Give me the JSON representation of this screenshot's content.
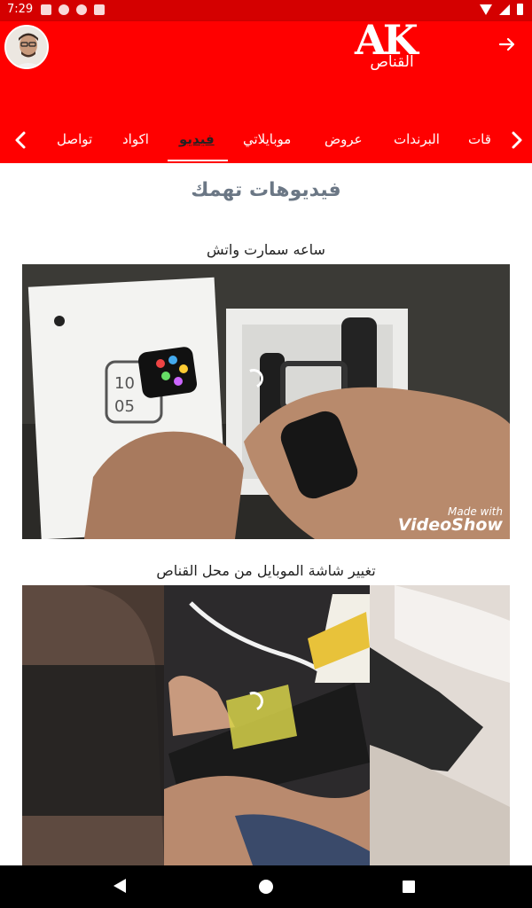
{
  "status_bar": {
    "time": "7:29",
    "icons": [
      "notification-icon",
      "notification-icon",
      "notification-icon",
      "sd-card-icon",
      "wifi-icon",
      "signal-icon",
      "battery-icon"
    ]
  },
  "header": {
    "logo_text": "AK",
    "logo_subtext": "القناص",
    "forward_icon": "arrow-right-icon",
    "avatar_icon": "user-avatar",
    "background": "#ff0000"
  },
  "tabs": {
    "items": [
      {
        "label": "قات"
      },
      {
        "label": "البرندات"
      },
      {
        "label": "عروض"
      },
      {
        "label": "موبايلاتي"
      },
      {
        "label": "فيديو"
      },
      {
        "label": "اكواد"
      },
      {
        "label": "تواصل"
      }
    ],
    "active_label": "فيديو"
  },
  "main": {
    "section_title": "فيديوهات تهمك",
    "videos": [
      {
        "title": "ساعه سمارت واتش",
        "watermark_small": "Made with",
        "watermark_big": "VideoShow"
      },
      {
        "title": "تغيير شاشة الموبايل من محل القناص"
      }
    ]
  },
  "nav_bar": {
    "back_icon": "back-icon",
    "home_icon": "home-icon",
    "recents_icon": "recents-icon"
  }
}
